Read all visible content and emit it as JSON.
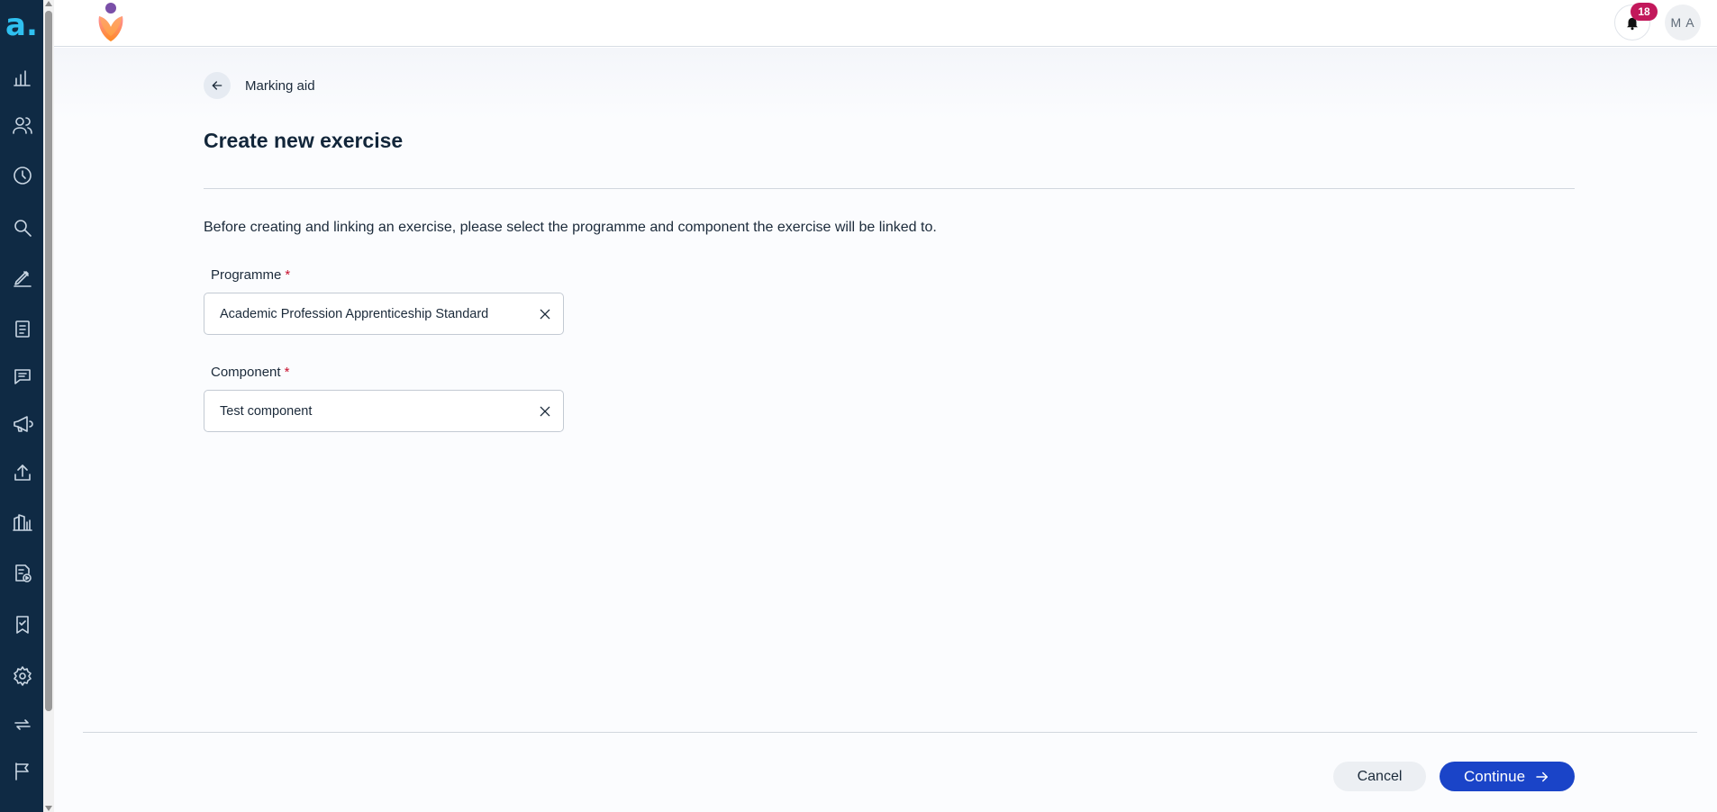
{
  "sidebar": {
    "logo_text": "a",
    "items": [
      {
        "icon": "bar-chart-icon"
      },
      {
        "icon": "users-icon"
      },
      {
        "icon": "clock-icon"
      },
      {
        "icon": "search-icon"
      },
      {
        "icon": "pen-icon"
      },
      {
        "icon": "clipboard-icon"
      },
      {
        "icon": "chat-icon"
      },
      {
        "icon": "megaphone-icon"
      },
      {
        "icon": "upload-icon"
      },
      {
        "icon": "report-icon"
      },
      {
        "icon": "document-play-icon"
      },
      {
        "icon": "badge-icon"
      },
      {
        "icon": "gear-icon"
      },
      {
        "icon": "repeat-icon"
      },
      {
        "icon": "flag-icon"
      }
    ]
  },
  "header": {
    "notification_count": "18",
    "avatar_initials": "M A"
  },
  "breadcrumb": {
    "back_label": "Marking aid"
  },
  "page": {
    "title": "Create new exercise",
    "intro": "Before creating and linking an exercise, please select the programme and component the exercise will be linked to."
  },
  "form": {
    "programme": {
      "label": "Programme",
      "required_mark": "*",
      "value": "Academic Profession Apprenticeship Standard"
    },
    "component": {
      "label": "Component",
      "required_mark": "*",
      "value": "Test component"
    }
  },
  "footer": {
    "cancel_label": "Cancel",
    "continue_label": "Continue"
  },
  "colors": {
    "sidebar_bg": "#0f2a44",
    "primary": "#1a44c8",
    "badge": "#c2185b",
    "required": "#c8102e"
  }
}
